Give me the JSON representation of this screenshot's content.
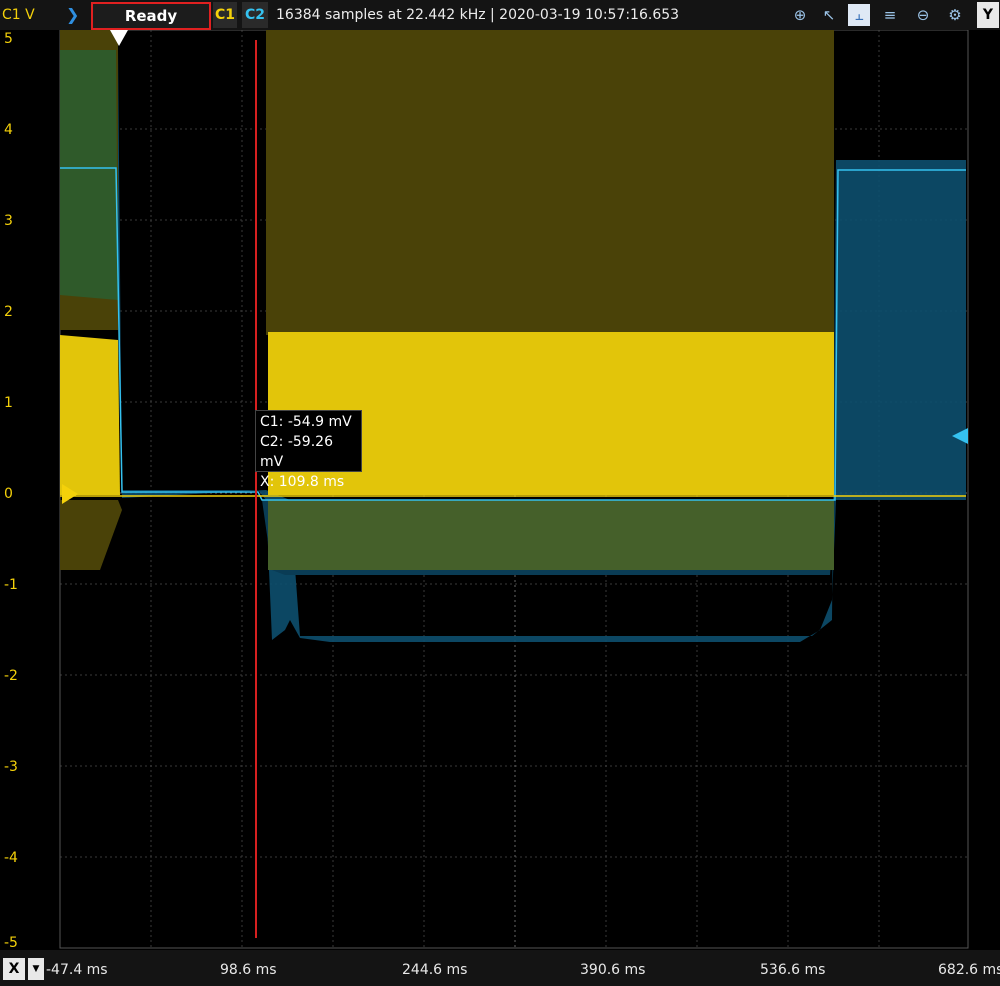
{
  "toolbar": {
    "y_channel_label": "C1 V",
    "status": "Ready",
    "channel1": "C1",
    "channel2": "C2",
    "acquisition_info": "16384 samples at 22.442 kHz | 2020-03-19 10:57:16.653",
    "icons": [
      "zoom-in-icon",
      "cursor-select-icon",
      "measure-icon",
      "stats-icon",
      "zoom-out-icon",
      "settings-icon"
    ],
    "y_button": "Y"
  },
  "x_axis": {
    "button": "X",
    "dropdown": "▼",
    "ticks": [
      "-47.4 ms",
      "98.6 ms",
      "244.6 ms",
      "390.6 ms",
      "536.6 ms",
      "682.6 ms"
    ]
  },
  "y_axis": {
    "ticks": [
      "5",
      "4",
      "3",
      "2",
      "1",
      "0",
      "-1",
      "-2",
      "-3",
      "-4",
      "-5"
    ]
  },
  "cursor": {
    "c1": "C1: -54.9 mV",
    "c2": "C2: -59.26 mV",
    "x": "X: 109.8 ms"
  },
  "colors": {
    "c1": "#f4d10a",
    "c2": "#35c2f0",
    "cursor_line": "#d62020",
    "grid": "#3a3a3a"
  }
}
